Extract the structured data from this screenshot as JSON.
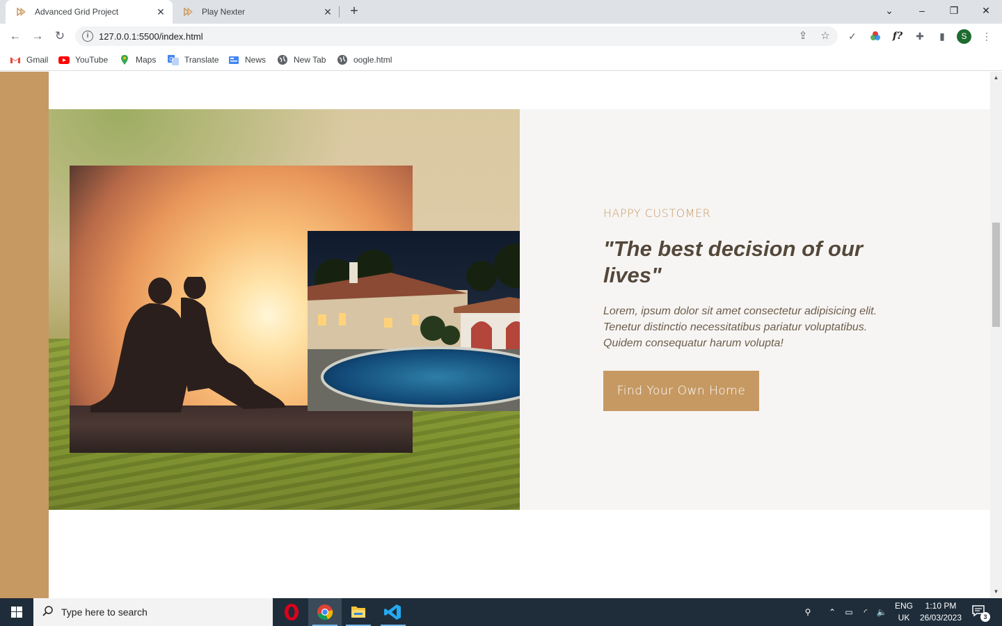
{
  "browser": {
    "tabs": [
      {
        "title": "Advanced Grid Project",
        "active": true
      },
      {
        "title": "Play Nexter",
        "active": false
      }
    ],
    "url": "127.0.0.1:5500/index.html",
    "profile_initial": "S",
    "bookmarks": [
      "Gmail",
      "YouTube",
      "Maps",
      "Translate",
      "News",
      "New Tab",
      "oogle.html"
    ]
  },
  "page": {
    "sub_heading": "HAPPY CUSTOMER",
    "quote": "\"The best decision of our lives\"",
    "text": "Lorem, ipsum dolor sit amet consectetur adipisicing elit. Tenetur distinctio necessitatibus pariatur voluptatibus. Quidem consequatur harum volupta!",
    "cta_label": "Find Your Own Home",
    "colors": {
      "primary": "#c69963",
      "dark": "#54483a",
      "light_bg": "#f7f5f4"
    }
  },
  "taskbar": {
    "search_placeholder": "Type here to search",
    "language": "ENG",
    "region": "UK",
    "time": "1:10 PM",
    "date": "26/03/2023",
    "notification_count": "3"
  }
}
